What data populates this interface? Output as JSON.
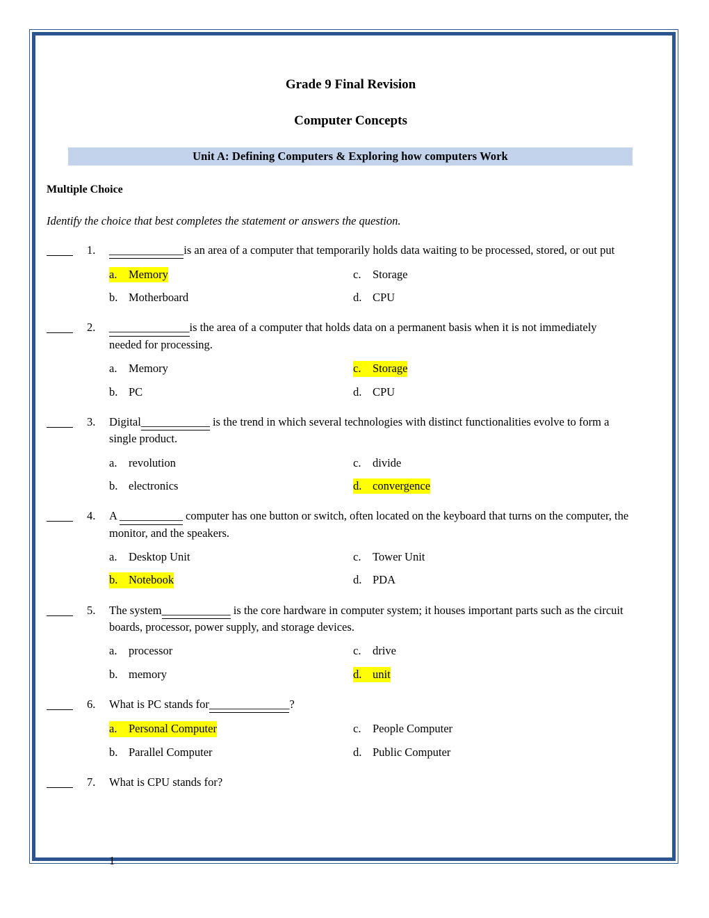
{
  "document": {
    "title_line_1": "Grade 9 Final Revision",
    "title_line_2": "Computer Concepts",
    "unit_banner": "Unit A: Defining Computers & Exploring how computers Work",
    "section_heading": "Multiple Choice",
    "section_instruction": "Identify the choice that best completes the statement or answers the question.",
    "page_number": "1",
    "colors": {
      "frame_blue": "#2c5490",
      "banner_fill": "#c3d3ec",
      "highlight_yellow": "#ffff00"
    }
  },
  "questions": [
    {
      "number": "1.",
      "text_before": "",
      "blank": "_____________",
      "text_after": "is an area of a computer that temporarily holds data waiting to be processed, stored, or out put",
      "choices": [
        {
          "letter": "a.",
          "text": "Memory",
          "highlighted": true
        },
        {
          "letter": "c.",
          "text": "Storage",
          "highlighted": false
        },
        {
          "letter": "b.",
          "text": "Motherboard",
          "highlighted": false
        },
        {
          "letter": "d.",
          "text": "CPU",
          "highlighted": false
        }
      ]
    },
    {
      "number": "2.",
      "text_before": "",
      "blank": "______________",
      "text_after": "is the area of a computer that holds data on a permanent basis when it is not immediately needed for processing.",
      "choices": [
        {
          "letter": "a.",
          "text": "Memory",
          "highlighted": false
        },
        {
          "letter": "c.",
          "text": "Storage",
          "highlighted": true
        },
        {
          "letter": "b.",
          "text": "PC",
          "highlighted": false
        },
        {
          "letter": "d.",
          "text": "CPU",
          "highlighted": false
        }
      ]
    },
    {
      "number": "3.",
      "text_before": "Digital",
      "blank": "____________",
      "text_after": " is the trend in which several technologies with distinct functionalities evolve to form a single product.",
      "choices": [
        {
          "letter": "a.",
          "text": "revolution",
          "highlighted": false
        },
        {
          "letter": "c.",
          "text": "divide",
          "highlighted": false
        },
        {
          "letter": "b.",
          "text": "electronics",
          "highlighted": false
        },
        {
          "letter": "d.",
          "text": "convergence",
          "highlighted": true
        }
      ]
    },
    {
      "number": "4.",
      "text_before": "A ",
      "blank": "___________",
      "text_after": " computer has one button or switch, often located on the keyboard that turns on the computer, the monitor, and the speakers.",
      "choices": [
        {
          "letter": "a.",
          "text": "Desktop Unit",
          "highlighted": false
        },
        {
          "letter": "c.",
          "text": "Tower Unit",
          "highlighted": false
        },
        {
          "letter": "b.",
          "text": "Notebook",
          "highlighted": true
        },
        {
          "letter": "d.",
          "text": "PDA",
          "highlighted": false
        }
      ]
    },
    {
      "number": "5.",
      "text_before": "The system",
      "blank": "____________",
      "text_after": " is the core hardware in computer system; it houses important parts such as the circuit boards, processor, power supply, and storage devices.",
      "choices": [
        {
          "letter": "a.",
          "text": "processor",
          "highlighted": false
        },
        {
          "letter": "c.",
          "text": "drive",
          "highlighted": false
        },
        {
          "letter": "b.",
          "text": "memory",
          "highlighted": false
        },
        {
          "letter": "d.",
          "text": "unit",
          "highlighted": true
        }
      ]
    },
    {
      "number": "6.",
      "text_before": "What is PC stands for",
      "blank": "______________",
      "text_after": "?",
      "choices": [
        {
          "letter": "a.",
          "text": "Personal Computer",
          "highlighted": true
        },
        {
          "letter": "c.",
          "text": "People Computer",
          "highlighted": false
        },
        {
          "letter": "b.",
          "text": "Parallel Computer",
          "highlighted": false
        },
        {
          "letter": "d.",
          "text": "Public Computer",
          "highlighted": false
        }
      ]
    },
    {
      "number": "7.",
      "text_before": "What is CPU stands for?",
      "blank": "",
      "text_after": "",
      "choices": []
    }
  ]
}
